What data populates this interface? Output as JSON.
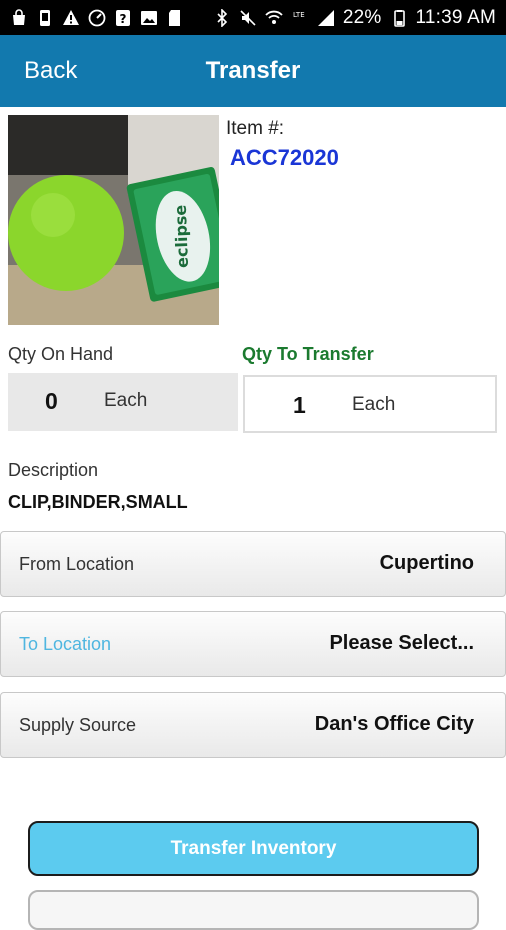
{
  "status_bar": {
    "battery_percent": "22%",
    "time": "11:39 AM",
    "left_icons": [
      "bag-icon",
      "phone-icon",
      "warning-icon",
      "speedometer-icon",
      "help-icon",
      "image-icon",
      "sdcard-icon"
    ],
    "right_icons": [
      "bluetooth-icon",
      "mute-icon",
      "wifi-icon",
      "lte-icon",
      "signal-icon",
      "battery-icon"
    ]
  },
  "nav": {
    "back_label": "Back",
    "title": "Transfer"
  },
  "item": {
    "label": "Item #:",
    "number": "ACC72020"
  },
  "qty": {
    "on_hand_label": "Qty On Hand",
    "on_hand_value": "0",
    "on_hand_unit": "Each",
    "transfer_label": "Qty To Transfer",
    "transfer_value": "1",
    "transfer_unit": "Each"
  },
  "description": {
    "label": "Description",
    "value": "CLIP,BINDER,SMALL"
  },
  "rows": {
    "from": {
      "label": "From Location",
      "value": "Cupertino"
    },
    "to": {
      "label": "To Location",
      "value": "Please Select..."
    },
    "supply": {
      "label": "Supply Source",
      "value": "Dan's Office City"
    }
  },
  "photo": {
    "box_text": "eclipse"
  },
  "buttons": {
    "transfer": "Transfer Inventory"
  },
  "colors": {
    "nav_bar": "#1279ae",
    "item_number": "#1a36d6",
    "transfer_label": "#1b7a2f",
    "to_location_label": "#4fb6e0",
    "primary_button": "#5ccbef"
  }
}
